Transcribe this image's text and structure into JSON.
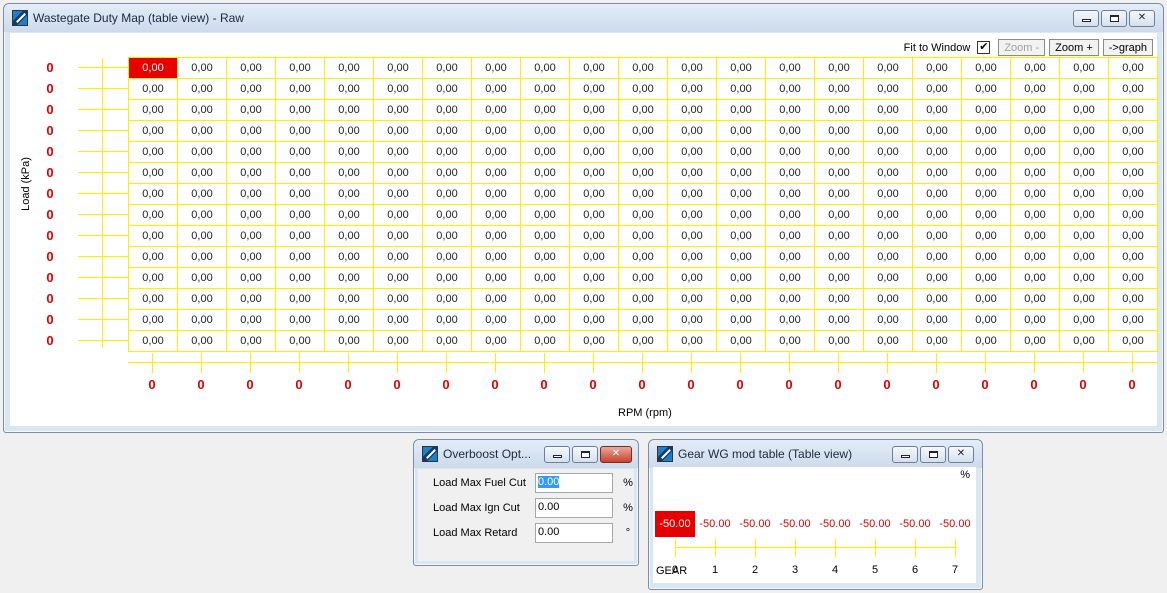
{
  "main_window": {
    "title": "Wastegate Duty Map (table view) - Raw",
    "toolbar": {
      "fit_label": "Fit to Window",
      "fit_checked": "✔",
      "zoom_minus": "Zoom -",
      "zoom_plus": "Zoom +",
      "to_graph": "->graph"
    },
    "y_axis_title": "Load (kPa)",
    "x_axis_title": "RPM (rpm)",
    "row_labels": [
      "0",
      "0",
      "0",
      "0",
      "0",
      "0",
      "0",
      "0",
      "0",
      "0",
      "0",
      "0",
      "0",
      "0"
    ],
    "col_labels": [
      "0",
      "0",
      "0",
      "0",
      "0",
      "0",
      "0",
      "0",
      "0",
      "0",
      "0",
      "0",
      "0",
      "0",
      "0",
      "0",
      "0",
      "0",
      "0",
      "0",
      "0"
    ],
    "cell_value": "0,00",
    "rows": 14,
    "cols": 21
  },
  "overboost_window": {
    "title": "Overboost Opt...",
    "fields": [
      {
        "label": "Load Max Fuel Cut",
        "value": "0.00",
        "unit": "%"
      },
      {
        "label": "Load Max Ign Cut",
        "value": "0.00",
        "unit": "%"
      },
      {
        "label": "Load Max Retard",
        "value": "0.00",
        "unit": "°"
      }
    ]
  },
  "gear_window": {
    "title": "Gear WG mod table (Table view)",
    "unit": "%",
    "values": [
      "-50.00",
      "-50.00",
      "-50.00",
      "-50.00",
      "-50.00",
      "-50.00",
      "-50.00",
      "-50.00"
    ],
    "gears": [
      "0",
      "1",
      "2",
      "3",
      "4",
      "5",
      "6",
      "7"
    ],
    "axis_title": "GEAR"
  }
}
